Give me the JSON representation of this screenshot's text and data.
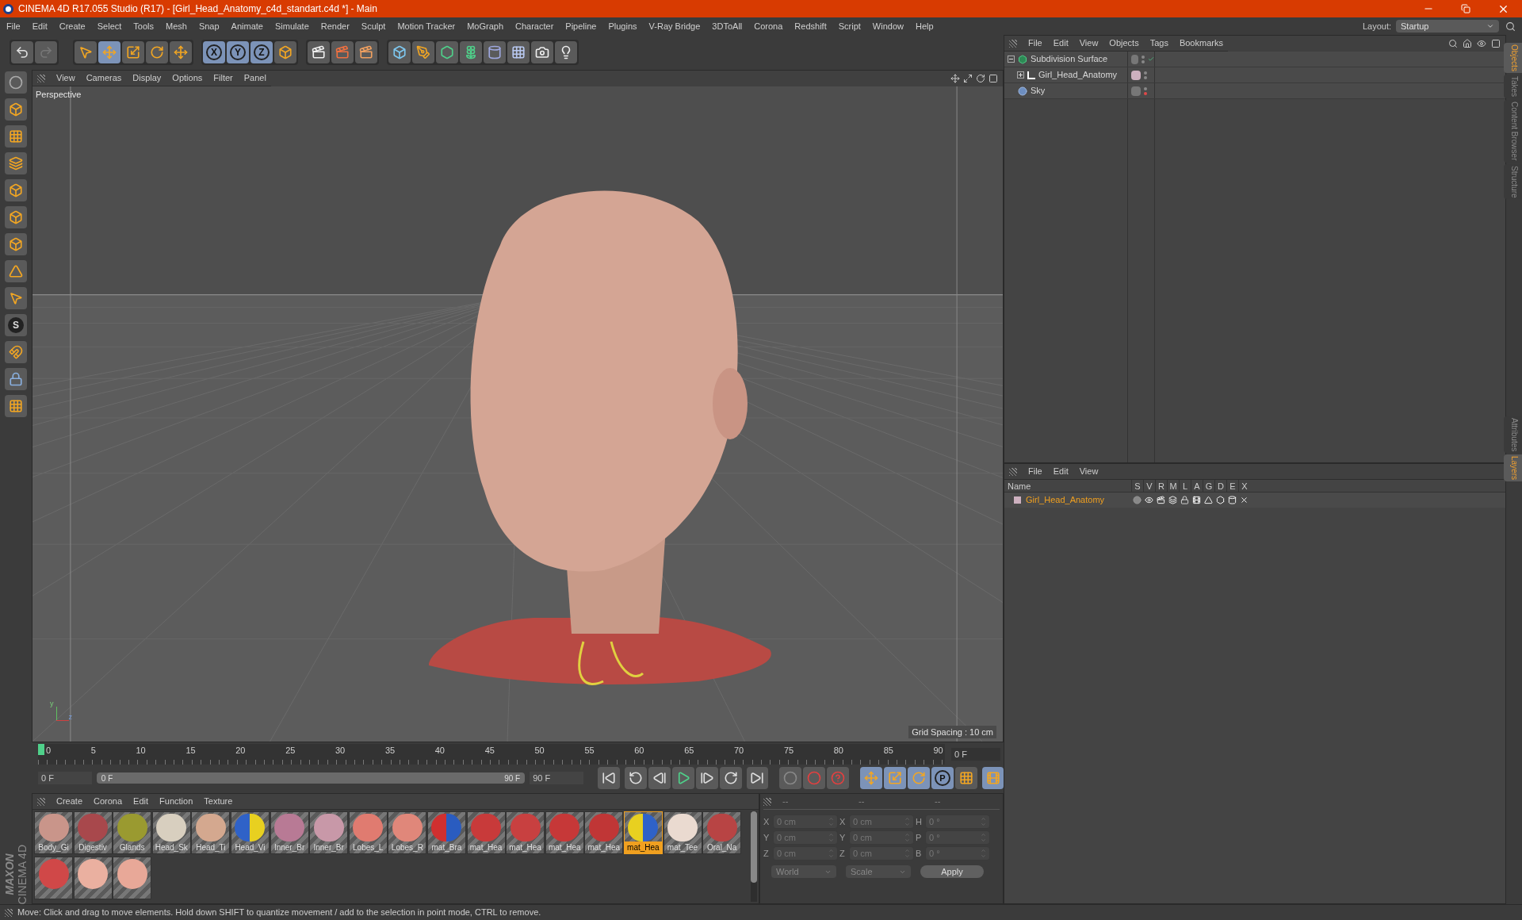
{
  "window": {
    "title": "CINEMA 4D R17.055 Studio (R17) - [Girl_Head_Anatomy_c4d_standart.c4d *] - Main"
  },
  "menu": [
    "File",
    "Edit",
    "Create",
    "Select",
    "Tools",
    "Mesh",
    "Snap",
    "Animate",
    "Simulate",
    "Render",
    "Sculpt",
    "Motion Tracker",
    "MoGraph",
    "Character",
    "Pipeline",
    "Plugins",
    "V-Ray Bridge",
    "3DToAll",
    "Corona",
    "Redshift",
    "Script",
    "Window",
    "Help"
  ],
  "layout": {
    "label": "Layout:",
    "value": "Startup"
  },
  "toolbar": {
    "axis_buttons": [
      {
        "label": "X",
        "selected": true
      },
      {
        "label": "Y",
        "selected": true
      },
      {
        "label": "Z",
        "selected": true
      }
    ]
  },
  "left_tools": {
    "snap_label": "S"
  },
  "logo": {
    "brand": "MAXON",
    "product": "CINEMA 4D"
  },
  "viewport": {
    "menu": [
      "View",
      "Cameras",
      "Display",
      "Options",
      "Filter",
      "Panel"
    ],
    "camera": "Perspective",
    "grid_spacing": "Grid Spacing : 10 cm",
    "axis_labels": [
      "y",
      "z"
    ]
  },
  "object_manager": {
    "menu": [
      "File",
      "Edit",
      "View",
      "Objects",
      "Tags",
      "Bookmarks"
    ],
    "objects": [
      {
        "name": "Subdivision Surface",
        "kind": "subdivision",
        "expanded": true,
        "checked": true,
        "render_off": false,
        "children": [
          {
            "name": "Girl_Head_Anatomy",
            "kind": "null",
            "expanded": false,
            "checked": false,
            "render_off": false
          }
        ]
      },
      {
        "name": "Sky",
        "kind": "sky",
        "checked": false,
        "render_off": true
      }
    ]
  },
  "side_tabs_top": [
    {
      "label": "Objects",
      "selected": true
    },
    {
      "label": "Takes",
      "selected": false
    },
    {
      "label": "Content Browser",
      "selected": false
    },
    {
      "label": "Structure",
      "selected": false
    }
  ],
  "side_tabs_bottom": [
    {
      "label": "Attributes",
      "selected": false
    },
    {
      "label": "Layers",
      "selected": true
    }
  ],
  "layers": {
    "menu": [
      "File",
      "Edit",
      "View"
    ],
    "columns": [
      "Name",
      "S",
      "V",
      "R",
      "M",
      "L",
      "A",
      "G",
      "D",
      "E",
      "X"
    ],
    "rows": [
      {
        "name": "Girl_Head_Anatomy",
        "color": "#cdb0bf",
        "selected": true
      }
    ]
  },
  "timeline": {
    "ticks": [
      "0",
      "5",
      "10",
      "15",
      "20",
      "25",
      "30",
      "35",
      "40",
      "45",
      "50",
      "55",
      "60",
      "65",
      "70",
      "75",
      "80",
      "85",
      "90"
    ],
    "level": 0,
    "current_frame": "0 F",
    "start": "0 F",
    "range": {
      "start": "0 F",
      "end": "90 F",
      "level": 1
    },
    "end": "90 F",
    "key_label": "P"
  },
  "materials": {
    "menu": [
      "Create",
      "Corona",
      "Edit",
      "Function",
      "Texture"
    ],
    "items": [
      {
        "name": "Body_Gi",
        "color": "#c9958a",
        "selected": false
      },
      {
        "name": "Digestiv",
        "color": "#a8484c",
        "selected": false
      },
      {
        "name": "Glands",
        "color": "#9a9a30",
        "selected": false
      },
      {
        "name": "Head_Sk",
        "color": "#d8cfbf",
        "selected": false
      },
      {
        "name": "Head_Ti",
        "color": "#d4a88f",
        "selected": false
      },
      {
        "name": "Head_Vi",
        "halves": [
          {
            "color": "#2f62c8"
          },
          {
            "color": "#e8d020"
          }
        ],
        "selected": false
      },
      {
        "name": "Inner_Br",
        "color": "#b87a95",
        "selected": false
      },
      {
        "name": "Inner_Br",
        "color": "#c898a8",
        "selected": false
      },
      {
        "name": "Lobes_L",
        "color": "#e07b70",
        "selected": false
      },
      {
        "name": "Lobes_R",
        "color": "#e0877a",
        "selected": false
      },
      {
        "name": "mat_Bra",
        "halves": [
          {
            "color": "#d03030"
          },
          {
            "color": "#2a5cc0"
          }
        ],
        "selected": false
      },
      {
        "name": "mat_Hea",
        "color": "#c83a3a",
        "selected": false
      },
      {
        "name": "mat_Hea",
        "color": "#c84040",
        "selected": false
      },
      {
        "name": "mat_Hea",
        "color": "#c63838",
        "selected": false
      },
      {
        "name": "mat_Hea",
        "color": "#c03636",
        "selected": false
      },
      {
        "name": "mat_Hea",
        "halves": [
          {
            "color": "#e8d020"
          },
          {
            "color": "#2f62c8"
          }
        ],
        "selected": true
      },
      {
        "name": "mat_Tee",
        "color": "#eadad0",
        "selected": false
      },
      {
        "name": "Oral_Na",
        "color": "#b84444",
        "selected": false
      },
      {
        "color": "#d04848",
        "selected": false
      },
      {
        "color": "#eab0a0",
        "selected": false
      },
      {
        "color": "#e8a898",
        "selected": false
      }
    ]
  },
  "coordinates": {
    "headers": [
      "--",
      "--",
      "--"
    ],
    "rows": [
      {
        "axis": "X",
        "position": "0 cm",
        "size_axis": "X",
        "size": "0 cm",
        "rot_axis": "H",
        "rotation": "0 °"
      },
      {
        "axis": "Y",
        "position": "0 cm",
        "size_axis": "Y",
        "size": "0 cm",
        "rot_axis": "P",
        "rotation": "0 °"
      },
      {
        "axis": "Z",
        "position": "0 cm",
        "size_axis": "Z",
        "size": "0 cm",
        "rot_axis": "B",
        "rotation": "0 °"
      }
    ],
    "mode": "World",
    "transform": "Scale",
    "apply": "Apply"
  },
  "status_bar": "Move: Click and drag to move elements. Hold down SHIFT to quantize movement / add to the selection in point mode, CTRL to remove."
}
